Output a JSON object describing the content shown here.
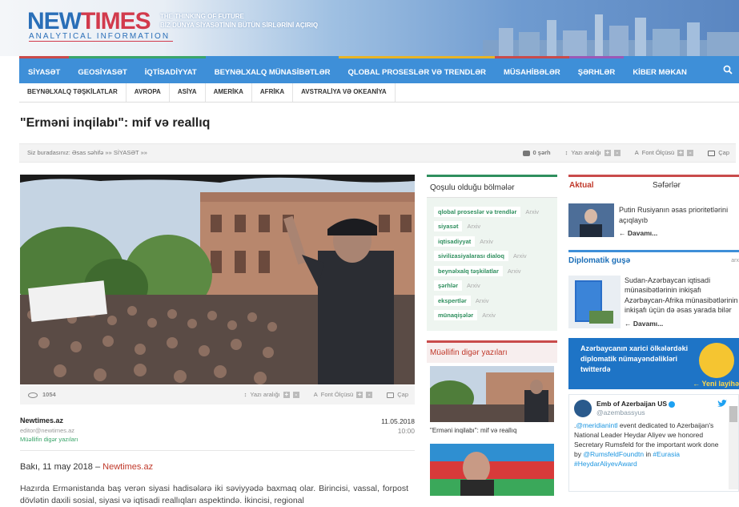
{
  "header": {
    "logo_main": "NEW",
    "logo_accent": "TIMES",
    "logo_sub": "ANALYTICAL INFORMATION",
    "tagline_1": "THE THINKING OF FUTURE",
    "tagline_2": "BİZ DÜNYA SİYASƏTİNİN BÜTÜN SİRLƏRİNİ AÇIRIQ"
  },
  "nav": {
    "items": [
      {
        "label": "SİYASƏT",
        "color": "#c94b4b"
      },
      {
        "label": "GEOSİYASƏT",
        "color": "#3aa56a"
      },
      {
        "label": "İQTİSADİYYAT",
        "color": "#3aa56a"
      },
      {
        "label": "BEYNƏLXALQ MÜNASİBƏTLƏR",
        "color": "#3e8fd8"
      },
      {
        "label": "QLOBAL PROSESLƏR VƏ TRENDLƏR",
        "color": "#e8b425"
      },
      {
        "label": "MÜSAHİBƏLƏR",
        "color": "#c94b4b"
      },
      {
        "label": "ŞƏRHLƏR",
        "color": "#9b59b6"
      },
      {
        "label": "KİBER MƏKAN",
        "color": "#3e8fd8"
      }
    ],
    "search_icon": "search-icon"
  },
  "subnav": {
    "items": [
      "BEYNƏLXALQ TƏŞKİLATLAR",
      "AVROPA",
      "ASİYA",
      "AMERİKA",
      "AFRİKA",
      "AVSTRALİYA VƏ OKEANİYA"
    ]
  },
  "article": {
    "title": "\"Erməni inqilabı\": mif və reallıq",
    "breadcrumb_prefix": "Siz buradasınız:",
    "breadcrumb_home": "Əsas səhifə",
    "breadcrumb_sep": "»»",
    "breadcrumb_section": "SİYASƏT",
    "comments": "0 şərh",
    "line_spacing": "Yazı aralığı",
    "font_size": "Font Ölçüsü",
    "print": "Çap",
    "views": "1054",
    "author_name": "Newtimes.az",
    "author_email": "editor@newtimes.az",
    "author_more": "Müəllifin digər yazıları",
    "date": "11.05.2018",
    "time": "10:00",
    "dateline_place": "Bakı, 11 may 2018 – ",
    "dateline_source": "Newtimes.az",
    "body": "Hazırda Ermənistanda baş verən siyasi hadisələrə iki səviyyədə baxmaq olar. Birincisi, vassal, forpost dövlətin daxili sosial, siyasi və iqtisadi reallıqları aspektində. İkincisi, regional"
  },
  "sections": {
    "title": "Qoşulu olduğu bölmələr",
    "archive_label": "Arxiv",
    "items": [
      "qlobal proseslər və trendlər",
      "siyasət",
      "iqtisadiyyat",
      "sivilizasiyalarası dialoq",
      "beynəlxalq təşkilatlar",
      "şərhlər",
      "ekspertlər",
      "münaqişələr"
    ]
  },
  "other_posts": {
    "title": "Müəllifin digər yazıları",
    "items": [
      "\"Erməni inqilabı\": mif və reallıq"
    ]
  },
  "sidebar": {
    "tab_actual": "Aktual",
    "tab_trips": "Səfərlər",
    "news_1": "Putin Rusiyanın əsas prioritetlərini açıqlayıb",
    "more": "Davamı...",
    "diplomatic_title": "Diplomatik guşə",
    "diplomatic_archive": "arx",
    "diplomatic_news": "Sudan-Azərbaycan iqtisadi münasibətlərinin inkişafı Azərbaycan-Afrika münasibətlərinin inkişafı üçün də əsas yarada bilər",
    "banner_text": "Azərbaycanın xarici ölkələrdəki diplomatik nümayəndəlikləri twitterdə",
    "banner_new": "Yeni layihə",
    "tweet": {
      "name": "Emb of Azerbaijan US",
      "handle": "@azembassyus",
      "pre": ".",
      "mention": "@meridianintl",
      "text1": " event dedicated to Azerbaijan's National Leader Heydar Aliyev we honored Secretary Rumsfeld for the important work done by ",
      "mention2": "@RumsfeldFoundtn",
      "text2": " in ",
      "tag1": "#Eurasia",
      "tag2": "#HeydarAliyevAward"
    }
  }
}
